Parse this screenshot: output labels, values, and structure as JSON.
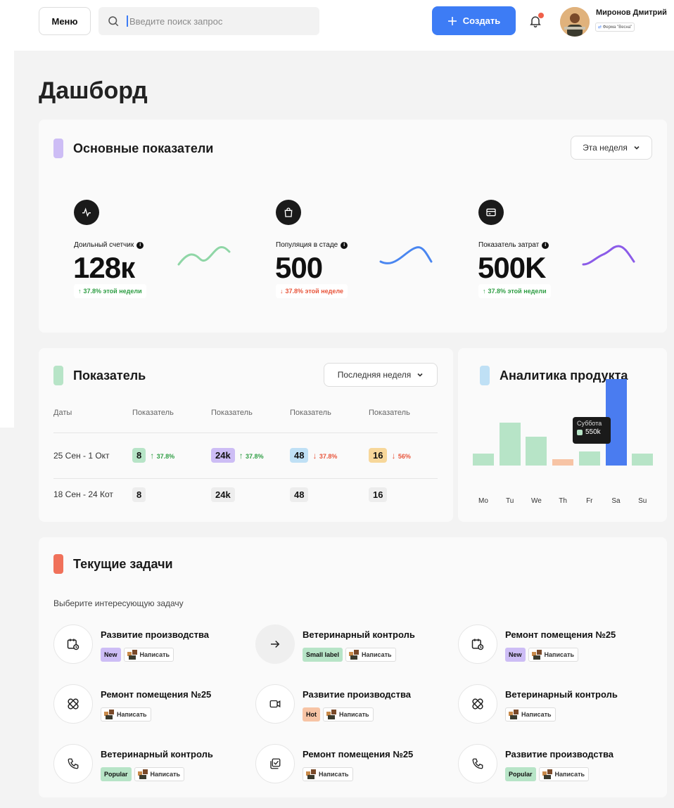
{
  "header": {
    "menu_label": "Меню",
    "search_placeholder": "Введите поиск запрос",
    "create_label": "Создать",
    "user": {
      "name": "Миронов Дмитрий",
      "farm": "Ферма \"Весна\""
    }
  },
  "page": {
    "title": "Дашборд"
  },
  "kpi_section": {
    "title": "Основные показатели",
    "period": "Эта неделя",
    "cards": [
      {
        "label": "Доильный счетчик",
        "value": "128к",
        "delta": "37.8% этой недели",
        "trend": "up",
        "icon": "activity-icon",
        "bg": "#e8f3ec",
        "line": "#8fd6a6"
      },
      {
        "label": "Популяция в стаде",
        "value": "500",
        "delta": "37.8% этой неделе",
        "trend": "down",
        "icon": "shopping-bag-icon",
        "bg": "#e8f4fc",
        "line": "#4a86f0"
      },
      {
        "label": "Показатель затрат",
        "value": "500K",
        "delta": "37.8% этой недели",
        "trend": "up",
        "icon": "credit-card-icon",
        "bg": "#eeeafc",
        "line": "#8b5be8"
      }
    ]
  },
  "indicators": {
    "title": "Показатель",
    "period": "Последняя неделя",
    "columns": [
      "Даты",
      "Показатель",
      "Показатель",
      "Показатель",
      "Показатель"
    ],
    "rows": [
      {
        "date": "25 Сен - 1 Окт",
        "cells": [
          {
            "value": "8",
            "delta": "37.8%",
            "trend": "up",
            "color": "#b7e4c7"
          },
          {
            "value": "24k",
            "delta": "37.8%",
            "trend": "up",
            "color": "#cdbdf5"
          },
          {
            "value": "48",
            "delta": "37.8%",
            "trend": "down",
            "color": "#bfe0f5"
          },
          {
            "value": "16",
            "delta": "56%",
            "trend": "down",
            "color": "#f7d79a"
          }
        ]
      },
      {
        "date": "18 Сен - 24 Кот",
        "cells": [
          {
            "value": "8",
            "delta": "",
            "trend": "",
            "color": "#ededed"
          },
          {
            "value": "24k",
            "delta": "",
            "trend": "",
            "color": "#ededed"
          },
          {
            "value": "48",
            "delta": "",
            "trend": "",
            "color": "#ededed"
          },
          {
            "value": "16",
            "delta": "",
            "trend": "",
            "color": "#ededed"
          }
        ]
      }
    ]
  },
  "analytics": {
    "title": "Аналитика продукта",
    "tooltip": {
      "day": "Суббота",
      "value": "550k"
    }
  },
  "chart_data": {
    "type": "bar",
    "categories": [
      "Mo",
      "Tu",
      "We",
      "Th",
      "Fr",
      "Sa",
      "Su"
    ],
    "values": [
      75,
      270,
      180,
      40,
      90,
      540,
      75
    ],
    "colors": [
      "#b7e4c7",
      "#b7e4c7",
      "#b7e4c7",
      "#f7c4a5",
      "#b7e4c7",
      "#4a7cf0",
      "#b7e4c7"
    ],
    "ylim": [
      0,
      550
    ],
    "highlight": "Sa"
  },
  "tasks": {
    "title": "Текущие задачи",
    "subtitle": "Выберите интересующую задачу",
    "write_label": "Написать",
    "items": [
      {
        "title": "Развитие производства",
        "icon": "calendar-clock-icon",
        "tag": "New",
        "tag_color": "#cdbdf5"
      },
      {
        "title": "Ветеринарный контроль",
        "icon": "arrow-right-icon",
        "tag": "Small label",
        "tag_color": "#b7e4c7"
      },
      {
        "title": "Ремонт помещения №25",
        "icon": "calendar-clock-icon",
        "tag": "New",
        "tag_color": "#cdbdf5"
      },
      {
        "title": "Ремонт помещения №25",
        "icon": "bandage-icon",
        "tag": "",
        "tag_color": ""
      },
      {
        "title": "Развитие производства",
        "icon": "video-icon",
        "tag": "Hot",
        "tag_color": "#f7c4a5"
      },
      {
        "title": "Ветеринарный контроль",
        "icon": "bandage-icon",
        "tag": "",
        "tag_color": ""
      },
      {
        "title": "Ветеринарный контроль",
        "icon": "phone-icon",
        "tag": "Popular",
        "tag_color": "#b7e4c7"
      },
      {
        "title": "Ремонт помещения №25",
        "icon": "checklist-icon",
        "tag": "",
        "tag_color": ""
      },
      {
        "title": "Развитие производства",
        "icon": "phone-icon",
        "tag": "Popular",
        "tag_color": "#b7e4c7"
      }
    ]
  }
}
